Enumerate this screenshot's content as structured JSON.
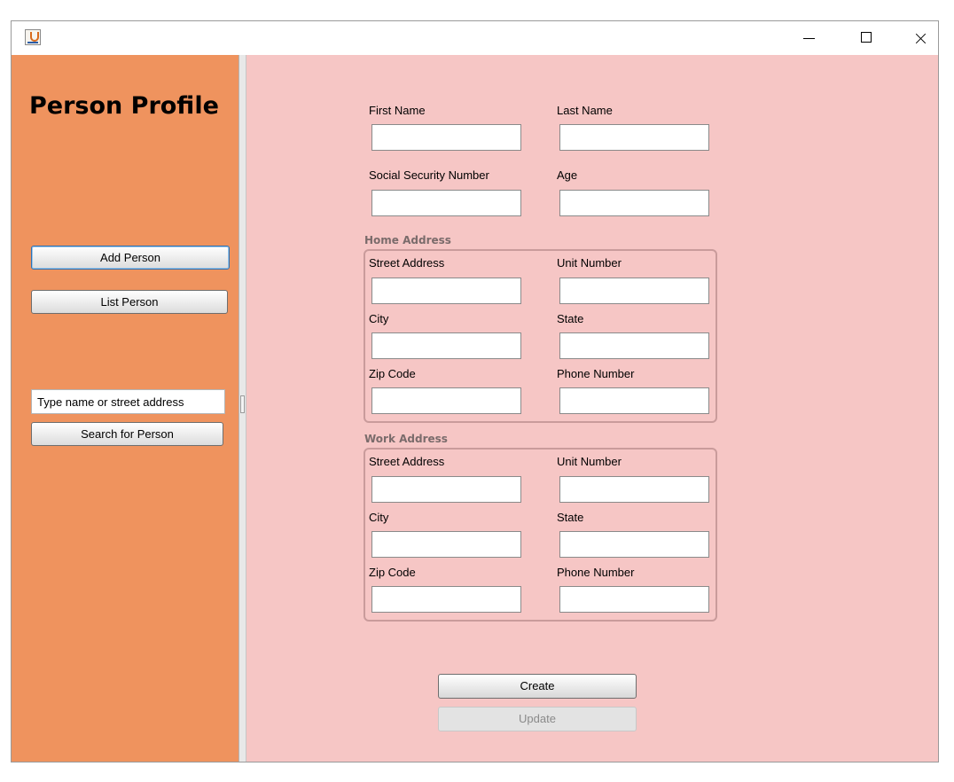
{
  "window": {
    "controls": {
      "minimize": "minimize-icon",
      "maximize": "maximize-icon",
      "close": "close-icon"
    },
    "app_icon": "java-cup-icon"
  },
  "sidebar": {
    "title": "Person Profile",
    "add_person_label": "Add Person",
    "list_person_label": "List Person",
    "search_placeholder": "Type name or street address",
    "search_button_label": "Search for Person"
  },
  "form": {
    "first_name_label": "First Name",
    "last_name_label": "Last Name",
    "ssn_label": "Social Security Number",
    "age_label": "Age",
    "home_address": {
      "title": "Home Address",
      "street_label": "Street Address",
      "unit_label": "Unit Number",
      "city_label": "City",
      "state_label": "State",
      "zip_label": "Zip Code",
      "phone_label": "Phone Number"
    },
    "work_address": {
      "title": "Work Address",
      "street_label": "Street Address",
      "unit_label": "Unit Number",
      "city_label": "City",
      "state_label": "State",
      "zip_label": "Zip Code",
      "phone_label": "Phone Number"
    },
    "create_label": "Create",
    "update_label": "Update"
  },
  "colors": {
    "sidebar_bg": "#ef935e",
    "main_bg": "#f6c6c5",
    "group_border": "#c99b9b",
    "disabled_text": "#8a8a8a"
  }
}
